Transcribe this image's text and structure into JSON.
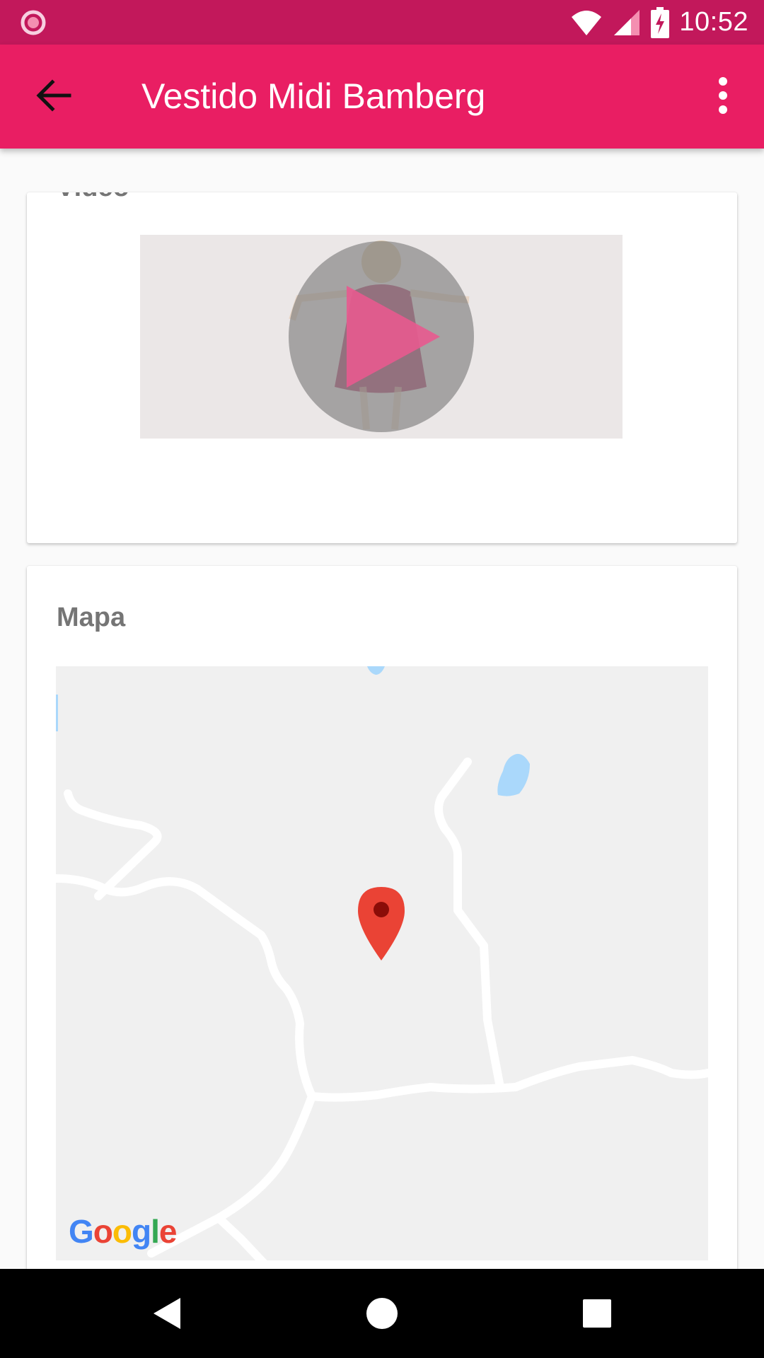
{
  "status_bar": {
    "time": "10:52",
    "icons": [
      "notification-icon",
      "wifi-icon",
      "cell-signal-icon",
      "battery-charging-icon"
    ],
    "color": "#c2185b"
  },
  "app_bar": {
    "title": "Vestido Midi Bamberg",
    "back_icon": "arrow-back-icon",
    "menu_icon": "more-vert-icon",
    "color": "#e91e63"
  },
  "video_card": {
    "heading": "Video",
    "play_icon": "play-icon"
  },
  "map_card": {
    "heading": "Mapa",
    "marker_icon": "map-marker-icon",
    "attribution": "Google"
  },
  "nav_bar": {
    "icons": [
      "back-triangle-icon",
      "home-circle-icon",
      "recents-square-icon"
    ]
  }
}
